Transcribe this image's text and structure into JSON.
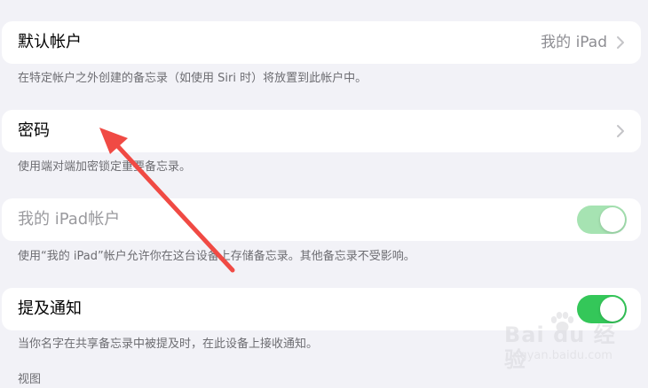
{
  "settings": {
    "default_account": {
      "label": "默认帐户",
      "value": "我的 iPad",
      "footer": "在特定帐户之外创建的备忘录（如使用 Siri 时）将放置到此帐户中。"
    },
    "password": {
      "label": "密码",
      "footer": "使用端对端加密锁定重要备忘录。"
    },
    "ipad_account": {
      "label": "我的 iPad帐户",
      "enabled": true,
      "disabled_appearance": true,
      "footer": "使用“我的 iPad”帐户允许你在这台设备上存储备忘录。其他备忘录不受影响。"
    },
    "mention_notifications": {
      "label": "提及通知",
      "enabled": true,
      "footer": "当你名字在共享备忘录中被提及时，在此设备上接收通知。"
    },
    "next_section_header": "视图"
  },
  "annotation": {
    "arrow_color": "#f04a44"
  },
  "watermark": {
    "brand": "Bai du 经验",
    "site": "jingyan.baidu.com"
  },
  "colors": {
    "background": "#f2f2f7",
    "toggle_on": "#34c759",
    "toggle_on_disabled": "#a6e3b2",
    "secondary_text": "#8e8e93",
    "footer_text": "#6d6d72"
  }
}
